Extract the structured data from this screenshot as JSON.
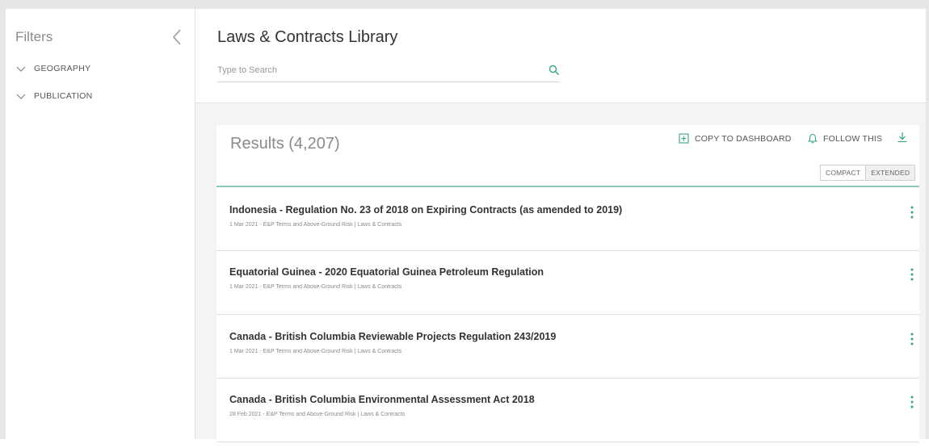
{
  "sidebar": {
    "title": "Filters",
    "filters": [
      {
        "label": "GEOGRAPHY"
      },
      {
        "label": "PUBLICATION"
      }
    ]
  },
  "header": {
    "title": "Laws & Contracts Library",
    "search_placeholder": "Type to Search"
  },
  "results": {
    "title": "Results (4,207)",
    "copy_label": "COPY TO DASHBOARD",
    "follow_label": "FOLLOW THIS",
    "view_options": [
      "COMPACT",
      "EXTENDED"
    ],
    "active_view": "EXTENDED",
    "items": [
      {
        "title": "Indonesia - Regulation No. 23 of 2018 on Expiring Contracts (as amended to 2019)",
        "meta": "1 Mar 2021 - E&P Terms and Above-Ground Risk | Laws & Contracts"
      },
      {
        "title": "Equatorial Guinea - 2020 Equatorial Guinea Petroleum Regulation",
        "meta": "1 Mar 2021 - E&P Terms and Above-Ground Risk | Laws & Contracts"
      },
      {
        "title": "Canada - British Columbia Reviewable Projects Regulation 243/2019",
        "meta": "1 Mar 2021 - E&P Terms and Above-Ground Risk | Laws & Contracts"
      },
      {
        "title": "Canada - British Columbia Environmental Assessment Act 2018",
        "meta": "28 Feb 2021 - E&P Terms and Above-Ground Risk | Laws & Contracts"
      }
    ]
  },
  "colors": {
    "accent": "#3aa676",
    "rule": "#8fc9b0"
  },
  "icons": {
    "collapse": "chevron-left-icon",
    "filter_toggle": "chevron-down-icon",
    "search": "search-icon",
    "copy": "plus-square-icon",
    "follow": "bell-icon",
    "download": "download-icon",
    "row_menu": "kebab-menu-icon"
  }
}
